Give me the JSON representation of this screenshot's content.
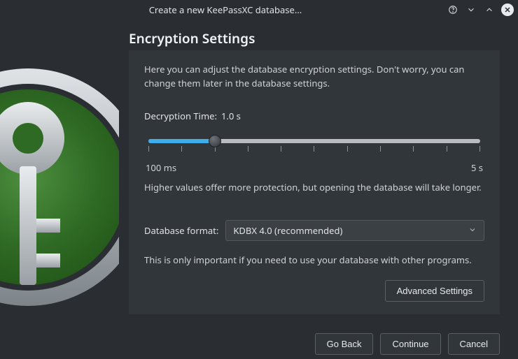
{
  "window": {
    "title": "Create a new KeePassXC database..."
  },
  "page": {
    "heading": "Encryption Settings",
    "intro": "Here you can adjust the database encryption settings. Don't worry, you can change them later in the database settings."
  },
  "slider": {
    "label": "Decryption Time:",
    "value_text": "1.0 s",
    "min_label": "100 ms",
    "max_label": "5 s",
    "hint": "Higher values offer more protection, but opening the database will take longer."
  },
  "format": {
    "label": "Database format:",
    "selected": "KDBX 4.0 (recommended)",
    "note": "This is only important if you need to use your database with other programs."
  },
  "buttons": {
    "advanced": "Advanced Settings",
    "back": "Go Back",
    "continue": "Continue",
    "cancel": "Cancel"
  }
}
